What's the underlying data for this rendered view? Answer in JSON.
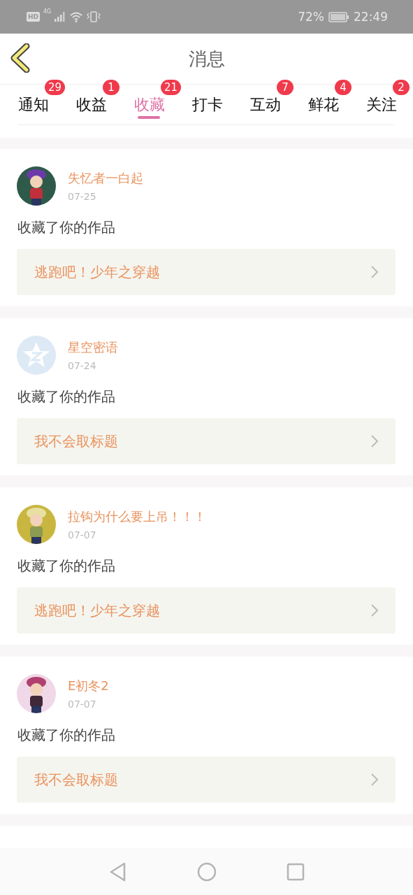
{
  "status_bar": {
    "hd": "HD",
    "network": "4G",
    "battery": "72%",
    "time": "22:49"
  },
  "header": {
    "title": "消息"
  },
  "tabs": [
    {
      "label": "通知",
      "badge": "29",
      "selected": false
    },
    {
      "label": "收益",
      "badge": "1",
      "selected": false
    },
    {
      "label": "收藏",
      "badge": "21",
      "selected": true
    },
    {
      "label": "打卡",
      "selected": false
    },
    {
      "label": "互动",
      "badge": "7",
      "selected": false
    },
    {
      "label": "鲜花",
      "badge": "4",
      "selected": false
    },
    {
      "label": "关注",
      "badge": "2",
      "selected": false
    }
  ],
  "messages": [
    {
      "user": "失忆者一白起",
      "date": "07-25",
      "action": "收藏了你的作品",
      "work": "逃跑吧！少年之穿越"
    },
    {
      "user": "星空密语",
      "date": "07-24",
      "avatar": {
        "kind": "default"
      },
      "action": "收藏了你的作品",
      "work": "我不会取标题"
    },
    {
      "user": "拉钩为什么要上吊！！！",
      "date": "07-07",
      "action": "收藏了你的作品",
      "work": "逃跑吧！少年之穿越"
    },
    {
      "user": "E初冬2",
      "date": "07-07",
      "action": "收藏了你的作品",
      "work": "我不会取标题"
    }
  ]
}
